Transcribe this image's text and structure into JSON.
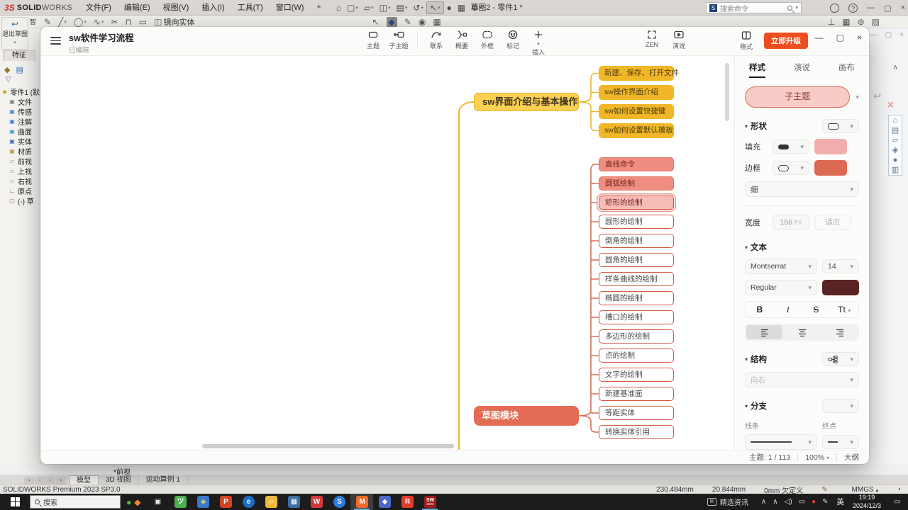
{
  "solidworks": {
    "brand": {
      "mark": "3S",
      "bold": "SOLID",
      "light": "WORKS"
    },
    "menus": [
      "文件(F)",
      "编辑(E)",
      "视图(V)",
      "插入(I)",
      "工具(T)",
      "窗口(W)"
    ],
    "quick_access": [
      {
        "name": "home-button",
        "icon": "home-icon"
      },
      {
        "name": "new-button",
        "icon": "new-icon",
        "caret": true
      },
      {
        "name": "open-button",
        "icon": "open-icon",
        "caret": true
      },
      {
        "name": "save-button",
        "icon": "save-icon",
        "caret": true
      },
      {
        "name": "print-button",
        "icon": "print-icon",
        "caret": true
      },
      {
        "name": "undo-button",
        "icon": "undo-icon",
        "caret": true
      },
      {
        "name": "pointer-button",
        "icon": "pointer-icon",
        "caret": true,
        "active": true
      },
      {
        "name": "trafficlight-button",
        "icon": "trafficlight-icon"
      },
      {
        "name": "evaluate-button",
        "icon": "evaluate-icon"
      },
      {
        "name": "gear-button",
        "icon": "gear-icon",
        "caret": true
      }
    ],
    "doc_title": "草图2 - 零件1 *",
    "search_placeholder": "搜索命令",
    "exit_sketch_label": "退出草图",
    "smart_dim_partial": "智",
    "features_tab": "特征",
    "mirror_label": "镜向实体",
    "sketch_tools": [
      {
        "name": "smart-dimension-icon",
        "icon": "dim-icon"
      },
      {
        "name": "line-tool-icon",
        "icon": "line-icon",
        "caret": true
      },
      {
        "name": "circle-tool-icon",
        "icon": "circle-icon",
        "caret": true
      },
      {
        "name": "spline-tool-icon",
        "icon": "spline-icon",
        "caret": true
      },
      {
        "name": "trim-tool-icon",
        "icon": "trim-icon"
      },
      {
        "name": "convert-tool-icon",
        "icon": "convert-icon"
      },
      {
        "name": "offset-tool-icon",
        "icon": "rect-icon"
      },
      {
        "name": "mirror-tool-icon",
        "icon": "mirror-icon"
      }
    ],
    "mid_tools": [
      {
        "name": "select-tool-icon",
        "icon": "pointer-icon"
      },
      {
        "name": "sketch-active-icon",
        "icon": "droplet-icon",
        "dark": true
      },
      {
        "name": "dim-tool-icon",
        "icon": "dim-icon"
      },
      {
        "name": "person-tool-icon",
        "icon": "person-icon"
      },
      {
        "name": "image-tool-icon",
        "icon": "image-icon"
      }
    ],
    "right_tools": [
      {
        "name": "perpendicular-icon",
        "icon": "perp-icon"
      },
      {
        "name": "pattern-icon",
        "icon": "grid-icon"
      },
      {
        "name": "display-style-icon",
        "icon": "display-icon"
      },
      {
        "name": "section-view-icon",
        "icon": "section-icon"
      }
    ],
    "tree": [
      {
        "icon": "part-icon",
        "label": "零件1 (默"
      },
      {
        "icon": "history-icon",
        "label": "文件"
      },
      {
        "icon": "sensors-icon",
        "label": "传感"
      },
      {
        "icon": "annotations-icon",
        "label": "注解"
      },
      {
        "icon": "surface-icon",
        "label": "曲面"
      },
      {
        "icon": "solid-icon",
        "label": "实体"
      },
      {
        "icon": "material-icon",
        "label": "材质"
      },
      {
        "icon": "plane-icon",
        "label": "前视"
      },
      {
        "icon": "plane-icon",
        "label": "上视"
      },
      {
        "icon": "plane-icon",
        "label": "右视"
      },
      {
        "icon": "origin-icon",
        "label": "原点"
      },
      {
        "icon": "sketch-icon",
        "label": "(-) 草"
      }
    ],
    "view_label": "*前视",
    "doc_tabs": [
      "模型",
      "3D 视图",
      "运动算例 1"
    ],
    "nav_arrows": [
      "«",
      "‹",
      "›",
      "»"
    ],
    "status": {
      "brand": "SOLIDWORKS Premium 2023 SP3.0",
      "x": "230.484mm",
      "y": "20.844mm",
      "z": "0mm",
      "state": "欠定义",
      "units": "MMGS"
    }
  },
  "mindmap": {
    "title": "sw软件学习流程",
    "subtitle": "已编辑",
    "toolbar": [
      {
        "name": "topic",
        "label": "主题"
      },
      {
        "name": "subtopic",
        "label": "子主题"
      },
      {
        "name": "sep",
        "label": ""
      },
      {
        "name": "relationship",
        "label": "联系"
      },
      {
        "name": "summary",
        "label": "概要"
      },
      {
        "name": "boundary",
        "label": "外框"
      },
      {
        "name": "marker",
        "label": "标记"
      },
      {
        "name": "insert",
        "label": "插入",
        "caret": true
      }
    ],
    "zen_label": "ZEN",
    "present_label": "演说",
    "panel": {
      "format_label": "格式",
      "upgrade_label": "立即升级",
      "tabs": [
        "样式",
        "演说",
        "画布"
      ],
      "preview_label": "子主题",
      "shape": {
        "title": "形状",
        "fill_label": "填充",
        "border_label": "边框",
        "border_width": "细",
        "width_label": "宽度",
        "width_value": "156",
        "width_unit": "PX",
        "fit_label": "适应",
        "fill_color": "#F2AEAC",
        "border_color": "#DC6952"
      },
      "text": {
        "title": "文本",
        "font": "Montserrat",
        "size": "14",
        "weight": "Regular",
        "color": "#5A2424",
        "bold": "B",
        "italic": "I",
        "strike": "S",
        "tt": "Tt"
      },
      "structure": {
        "title": "结构",
        "direction": "向右"
      },
      "branch": {
        "title": "分支",
        "line_label": "线条",
        "end_label": "终点",
        "width": "细",
        "color": "#E5604B"
      }
    },
    "statusbar": {
      "topics": "主题: 1 / 113",
      "zoom": "100%",
      "outline": "大纲"
    },
    "map": {
      "yellow_parent": "sw界面介绍与基本操作",
      "yellow_children": [
        "新建、保存、打开文件",
        "sw操作界面介绍",
        "sw如何设置快捷键",
        "sw如何设置默认模板"
      ],
      "red_parent": "草图模块",
      "red_children": [
        {
          "label": "直线命令",
          "style": "solid"
        },
        {
          "label": "圆弧绘制",
          "style": "solid"
        },
        {
          "label": "矩形的绘制",
          "style": "selected"
        },
        {
          "label": "圆形的绘制",
          "style": "outline"
        },
        {
          "label": "倒角的绘制",
          "style": "outline"
        },
        {
          "label": "圆角的绘制",
          "style": "outline"
        },
        {
          "label": "样条曲线的绘制",
          "style": "outline"
        },
        {
          "label": "椭圆的绘制",
          "style": "outline"
        },
        {
          "label": "槽口的绘制",
          "style": "outline"
        },
        {
          "label": "多边形的绘制",
          "style": "outline"
        },
        {
          "label": "点的绘制",
          "style": "outline"
        },
        {
          "label": "文字的绘制",
          "style": "outline"
        },
        {
          "label": "新建基准面",
          "style": "outline"
        },
        {
          "label": "等距实体",
          "style": "outline"
        },
        {
          "label": "转换实体引用",
          "style": "outline"
        }
      ],
      "colors": {
        "yellow_line": "#EDB52D",
        "red_line": "#DB6D58"
      }
    }
  },
  "taskbar": {
    "search_placeholder": "搜索",
    "news_label": "精选资讯",
    "lang": "英",
    "time": "19:19",
    "date": "2024/12/3",
    "widgets": [
      {
        "name": "widget-green-icon",
        "glyph": "●",
        "color": "#57b94c"
      },
      {
        "name": "widget-orange-icon",
        "glyph": "◆",
        "color": "#f2862c"
      }
    ],
    "apps": [
      {
        "name": "task-view-button",
        "letter": "▣",
        "bg": "transparent",
        "fg": "#e8e8e8"
      },
      {
        "name": "app-green",
        "letter": "ツ",
        "bg": "#4caf50",
        "fg": "#ffffff"
      },
      {
        "name": "app-compass",
        "letter": "◈",
        "bg": "#3b78c9",
        "fg": "#ffd95e"
      },
      {
        "name": "app-powerpoint",
        "letter": "P",
        "bg": "#d04423",
        "fg": "#ffffff"
      },
      {
        "name": "app-edge",
        "letter": "e",
        "bg": "#1b6ec2",
        "fg": "#ffffff",
        "round": true
      },
      {
        "name": "app-explorer",
        "letter": "▱",
        "bg": "#efb73e",
        "fg": "#fff8e0"
      },
      {
        "name": "app-calculator",
        "letter": "▦",
        "bg": "#3d6ea5",
        "fg": "#ffffff"
      },
      {
        "name": "app-wps",
        "letter": "W",
        "bg": "#d43a3a",
        "fg": "#ffffff"
      },
      {
        "name": "app-s-blue",
        "letter": "S",
        "bg": "#2a7de1",
        "fg": "#ffffff",
        "round": true
      },
      {
        "name": "app-mindmap",
        "letter": "M",
        "bg": "#f26b2a",
        "fg": "#ffffff",
        "active": true,
        "highlight": true
      },
      {
        "name": "app-blue",
        "letter": "◆",
        "bg": "#4a66c6",
        "fg": "#ffffff"
      },
      {
        "name": "app-red",
        "letter": "R",
        "bg": "#e03c2e",
        "fg": "#ffffff"
      },
      {
        "name": "app-solidworks",
        "letter": "SW",
        "sub": "2023",
        "bg": "#9e1c1c",
        "fg": "#ffffff",
        "active": true
      }
    ],
    "tray": [
      {
        "name": "hidden-icons-icon",
        "glyph": "∧"
      },
      {
        "name": "hidden-icons2-icon",
        "glyph": "∧"
      },
      {
        "name": "volume-icon",
        "glyph": "◁)"
      },
      {
        "name": "display-cast-icon",
        "glyph": "▭"
      },
      {
        "name": "record-icon",
        "glyph": "●",
        "color": "#e53935"
      },
      {
        "name": "pen-icon",
        "glyph": "✎"
      }
    ]
  },
  "icon_glyphs": {
    "home-icon": "⌂",
    "new-icon": "▢",
    "open-icon": "▱",
    "save-icon": "◫",
    "print-icon": "▤",
    "undo-icon": "↺",
    "pointer-icon": "↖",
    "trafficlight-icon": "●",
    "evaluate-icon": "▦",
    "gear-icon": "⚙",
    "pin-icon": "✶",
    "dim-icon": "✎",
    "line-icon": "╱",
    "circle-icon": "◯",
    "spline-icon": "∿",
    "rect-icon": "▭",
    "trim-icon": "✂",
    "convert-icon": "⊓",
    "mirror-icon": "◫",
    "droplet-icon": "◆",
    "person-icon": "◉",
    "image-icon": "▦",
    "perp-icon": "⊥",
    "grid-icon": "▦",
    "display-icon": "⊚",
    "section-icon": "▨",
    "min-icon": "—",
    "restore-icon": "▢",
    "close-icon": "×",
    "max-icon": "▢",
    "account-icon": "◎",
    "help-icon": "?",
    "chevron-down-icon": "▾",
    "collapse-icon": "∧",
    "confirm-sketch-icon": "↩",
    "confirm-x-icon": "×",
    "taskpane-home-icon": "⌂",
    "taskpane-library-icon": "▤",
    "taskpane-files-icon": "▱",
    "taskpane-palette-icon": "◈",
    "taskpane-web-icon": "●",
    "taskpane-list-icon": "▥",
    "exit-sketch-icon": "↩"
  }
}
